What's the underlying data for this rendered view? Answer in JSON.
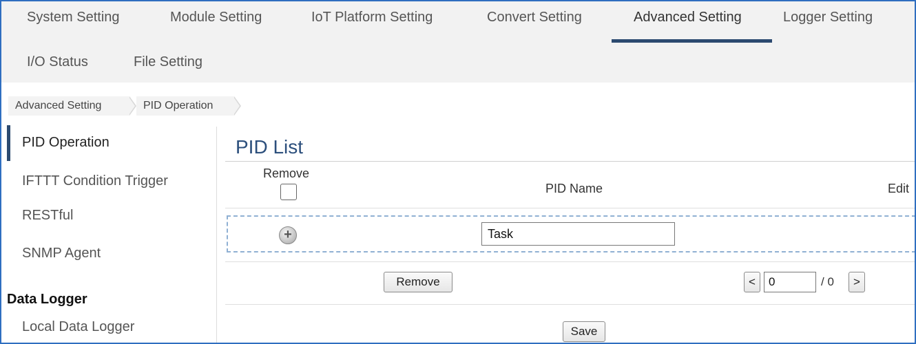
{
  "topnav": {
    "tabs": [
      {
        "label": "System Setting"
      },
      {
        "label": "Module Setting"
      },
      {
        "label": "IoT Platform Setting"
      },
      {
        "label": "Convert Setting"
      },
      {
        "label": "Advanced Setting",
        "active": true
      },
      {
        "label": "Logger Setting"
      },
      {
        "label": "I/O Status"
      },
      {
        "label": "File Setting"
      }
    ]
  },
  "breadcrumb": [
    "Advanced Setting",
    "PID Operation"
  ],
  "sidebar": {
    "items": [
      {
        "label": "PID Operation",
        "active": true
      },
      {
        "label": "IFTTT Condition Trigger"
      },
      {
        "label": "RESTful"
      },
      {
        "label": "SNMP Agent"
      }
    ],
    "section_title": "Data Logger",
    "section_items": [
      {
        "label": "Local Data Logger"
      }
    ]
  },
  "main": {
    "title": "PID List",
    "columns": {
      "remove": "Remove",
      "pid_name": "PID Name",
      "edit": "Edit"
    },
    "new_row": {
      "name_value": "Task",
      "add_icon": "plus-circle-icon"
    },
    "remove_button": "Remove",
    "pager": {
      "prev": "<",
      "next": ">",
      "current": "0",
      "total": "/ 0"
    },
    "save_button": "Save"
  },
  "colors": {
    "accent": "#2c4a70",
    "title": "#2c4f7c",
    "frame_border": "#2f6ec0",
    "nav_bg": "#f2f2f2",
    "dashed_row": "#8fb0d3"
  }
}
